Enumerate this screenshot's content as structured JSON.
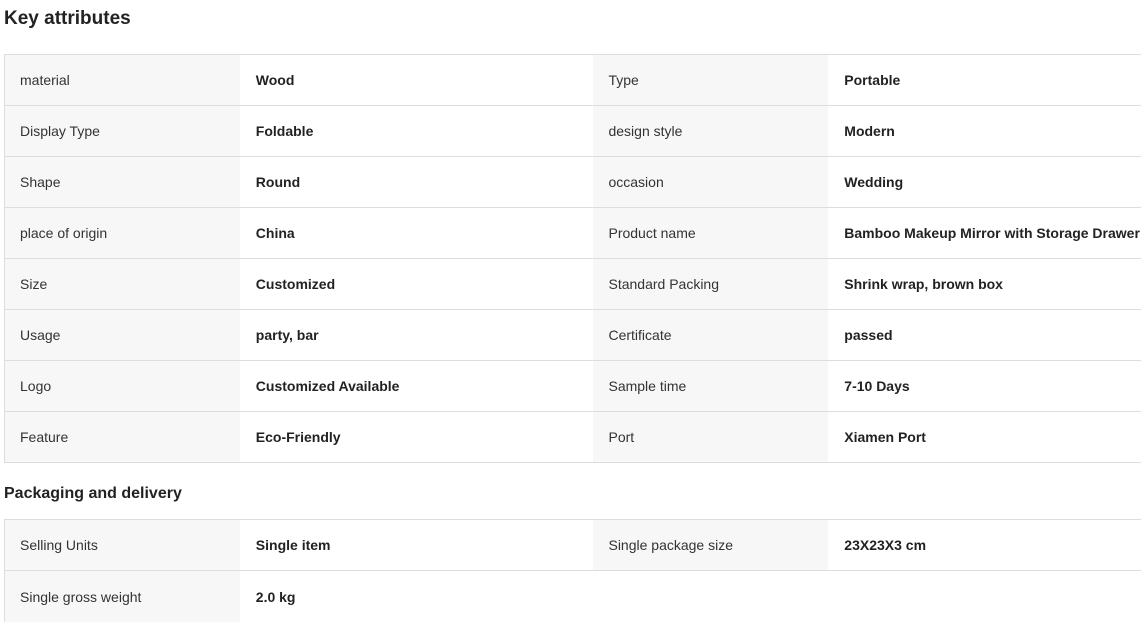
{
  "key_attributes": {
    "title": "Key attributes",
    "rows": [
      [
        {
          "k": "material",
          "v": "Wood"
        },
        {
          "k": "Type",
          "v": "Portable"
        }
      ],
      [
        {
          "k": "Display Type",
          "v": "Foldable"
        },
        {
          "k": "design style",
          "v": "Modern"
        }
      ],
      [
        {
          "k": "Shape",
          "v": "Round"
        },
        {
          "k": "occasion",
          "v": "Wedding"
        }
      ],
      [
        {
          "k": "place of origin",
          "v": "China"
        },
        {
          "k": "Product name",
          "v": "Bamboo Makeup Mirror with Storage Drawer"
        }
      ],
      [
        {
          "k": "Size",
          "v": "Customized"
        },
        {
          "k": "Standard Packing",
          "v": "Shrink wrap, brown box"
        }
      ],
      [
        {
          "k": "Usage",
          "v": "party, bar"
        },
        {
          "k": "Certificate",
          "v": "passed"
        }
      ],
      [
        {
          "k": "Logo",
          "v": "Customized Available"
        },
        {
          "k": "Sample time",
          "v": "7-10 Days"
        }
      ],
      [
        {
          "k": "Feature",
          "v": "Eco-Friendly"
        },
        {
          "k": "Port",
          "v": "Xiamen Port"
        }
      ]
    ]
  },
  "packaging": {
    "title": "Packaging and delivery",
    "rows": [
      [
        {
          "k": "Selling Units",
          "v": "Single item"
        },
        {
          "k": "Single package size",
          "v": "23X23X3 cm"
        }
      ],
      [
        {
          "k": "Single gross weight",
          "v": "2.0 kg"
        }
      ]
    ]
  }
}
